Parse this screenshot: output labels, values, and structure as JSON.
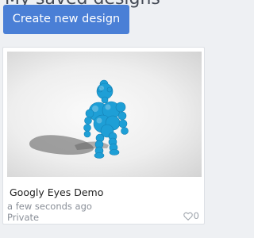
{
  "header": {
    "heading": "My saved designs",
    "create_button_label": "Create new design"
  },
  "design": {
    "title": "Googly Eyes Demo",
    "time": "a few seconds ago",
    "visibility": "Private",
    "like_count": "0",
    "model_color": "#1e9fd6",
    "like_icon": "heart-outline-icon"
  },
  "colors": {
    "primary_button": "#4a7fd6",
    "background": "#eef0f3",
    "muted_text": "#8a8f98"
  }
}
